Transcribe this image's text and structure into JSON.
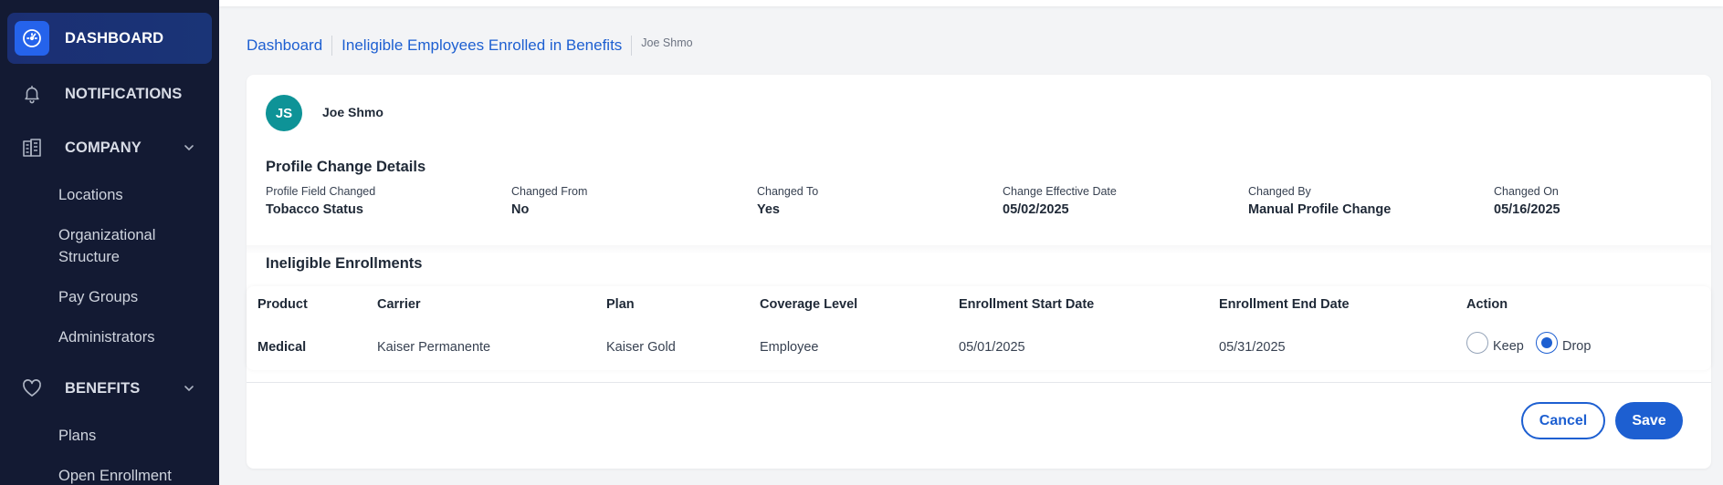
{
  "sidebar": {
    "dashboard": {
      "label": "DASHBOARD",
      "icon": "gauge-icon"
    },
    "notifications": {
      "label": "NOTIFICATIONS",
      "icon": "bell-icon"
    },
    "company": {
      "label": "COMPANY",
      "icon": "building-icon",
      "items": [
        "Locations",
        "Organizational Structure",
        "Pay Groups",
        "Administrators"
      ]
    },
    "benefits": {
      "label": "BENEFITS",
      "icon": "heart-icon",
      "items": [
        "Plans",
        "Open Enrollment"
      ]
    }
  },
  "breadcrumb": {
    "home": "Dashboard",
    "section": "Ineligible Employees Enrolled in Benefits",
    "current": "Joe Shmo"
  },
  "employee": {
    "initials": "JS",
    "name": "Joe Shmo"
  },
  "profile_change": {
    "title": "Profile Change Details",
    "fields": [
      {
        "label": "Profile Field Changed",
        "value": "Tobacco Status"
      },
      {
        "label": "Changed From",
        "value": "No"
      },
      {
        "label": "Changed To",
        "value": "Yes"
      },
      {
        "label": "Change Effective Date",
        "value": "05/02/2025"
      },
      {
        "label": "Changed By",
        "value": "Manual Profile Change"
      },
      {
        "label": "Changed On",
        "value": "05/16/2025"
      }
    ]
  },
  "enrollments": {
    "title": "Ineligible Enrollments",
    "columns": [
      "Product",
      "Carrier",
      "Plan",
      "Coverage Level",
      "Enrollment Start Date",
      "Enrollment End Date",
      "Action"
    ],
    "rows": [
      {
        "product": "Medical",
        "carrier": "Kaiser Permanente",
        "plan": "Kaiser Gold",
        "coverage": "Employee",
        "start": "05/01/2025",
        "end": "05/31/2025",
        "action_options": [
          "Keep",
          "Drop"
        ],
        "action_selected": "Drop"
      }
    ]
  },
  "actions": {
    "cancel": "Cancel",
    "save": "Save"
  },
  "colors": {
    "accent": "#1d5fd1",
    "sidebar_bg": "#131a33",
    "avatar": "#0e9397"
  }
}
